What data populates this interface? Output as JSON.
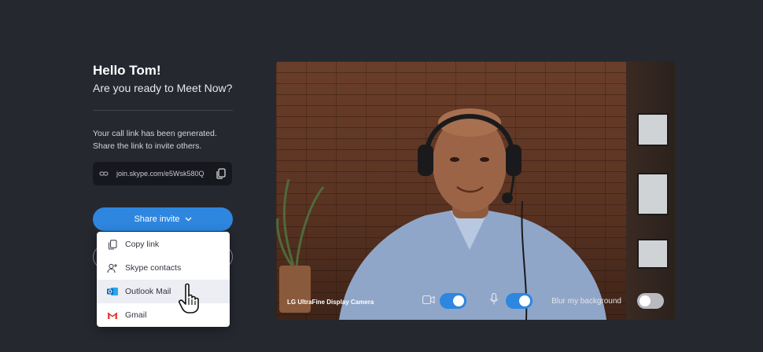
{
  "greeting": "Hello Tom!",
  "question": "Are you ready to Meet Now?",
  "info_text": "Your call link has been generated. Share the link to invite others.",
  "call_link": "join.skype.com/e5Wsk580Q",
  "share_button": "Share invite",
  "share_menu": [
    {
      "label": "Copy link",
      "icon": "copy-icon"
    },
    {
      "label": "Skype contacts",
      "icon": "add-contact-icon"
    },
    {
      "label": "Outlook Mail",
      "icon": "outlook-icon"
    },
    {
      "label": "Gmail",
      "icon": "gmail-icon"
    }
  ],
  "video": {
    "camera_label": "LG UltraFine Display Camera",
    "video_toggle": "on",
    "mic_toggle": "on",
    "blur_label": "Blur my background",
    "blur_toggle": "off"
  },
  "colors": {
    "background": "#262830",
    "accent": "#2e86df",
    "menu_hover": "#eceef3"
  }
}
